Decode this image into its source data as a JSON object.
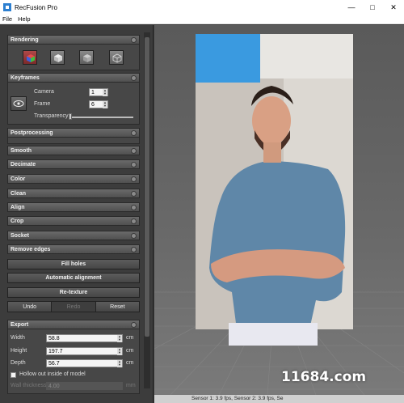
{
  "app": {
    "title": "RecFusion Pro"
  },
  "menu": {
    "file": "File",
    "help": "Help"
  },
  "rendering": {
    "header": "Rendering"
  },
  "keyframes": {
    "header": "Keyframes",
    "camera_label": "Camera",
    "camera_value": "1",
    "frame_label": "Frame",
    "frame_value": "6",
    "transparency_label": "Transparency",
    "transparency_value": 0.0
  },
  "postprocessing": {
    "header": "Postprocessing",
    "items": [
      "Smooth",
      "Decimate",
      "Color",
      "Clean",
      "Align",
      "Crop",
      "Socket",
      "Remove edges"
    ],
    "buttons": [
      "Fill holes",
      "Automatic alignment",
      "Re-texture"
    ],
    "undo": "Undo",
    "redo": "Redo",
    "reset": "Reset"
  },
  "export": {
    "header": "Export",
    "width_label": "Width",
    "width_value": "58.8",
    "width_unit": "cm",
    "height_label": "Height",
    "height_value": "197.7",
    "height_unit": "cm",
    "depth_label": "Depth",
    "depth_value": "56.7",
    "depth_unit": "cm",
    "hollow_label": "Hollow out inside of model",
    "wall_label": "Wall thickness",
    "wall_value": "4.00",
    "wall_unit": "mm"
  },
  "status": {
    "text": "Sensor 1: 3.9 fps, Sensor 2: 3.9 fps, Se"
  },
  "watermark": "11684.com",
  "colors": {
    "panel": "#3c3c3c",
    "header": "#5a5a5a",
    "active_render": "#a04040"
  }
}
